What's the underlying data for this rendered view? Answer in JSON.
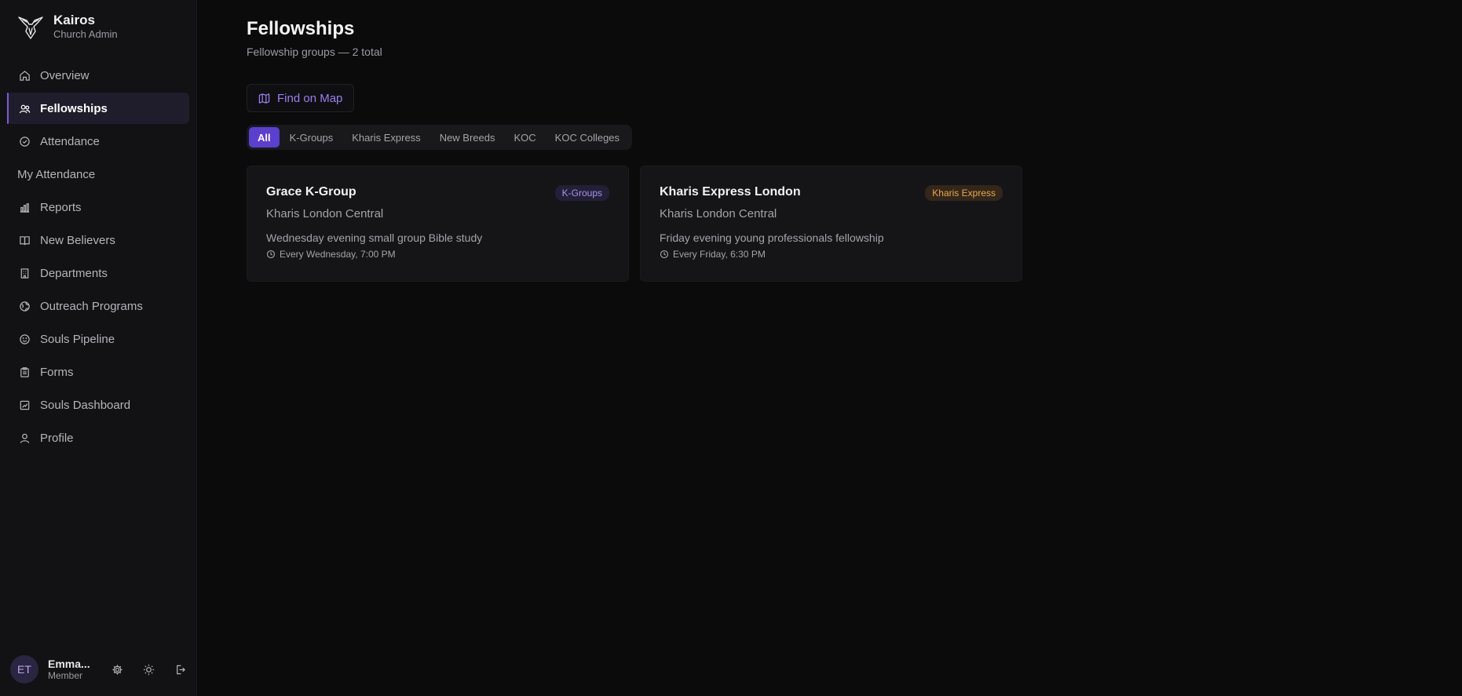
{
  "brand": {
    "title": "Kairos",
    "subtitle": "Church Admin",
    "logo_icon": "dove-icon"
  },
  "sidebar": {
    "items": [
      {
        "label": "Overview",
        "icon": "home-icon",
        "active": false
      },
      {
        "label": "Fellowships",
        "icon": "users-icon",
        "active": true
      },
      {
        "label": "Attendance",
        "icon": "check-circle-icon",
        "active": false
      },
      {
        "label": "My Attendance",
        "icon": "",
        "active": false
      },
      {
        "label": "Reports",
        "icon": "bar-chart-icon",
        "active": false
      },
      {
        "label": "New Believers",
        "icon": "book-icon",
        "active": false
      },
      {
        "label": "Departments",
        "icon": "building-icon",
        "active": false
      },
      {
        "label": "Outreach Programs",
        "icon": "globe-icon",
        "active": false
      },
      {
        "label": "Souls Pipeline",
        "icon": "smile-icon",
        "active": false
      },
      {
        "label": "Forms",
        "icon": "clipboard-icon",
        "active": false
      },
      {
        "label": "Souls Dashboard",
        "icon": "dashboard-icon",
        "active": false
      },
      {
        "label": "Profile",
        "icon": "user-icon",
        "active": false
      }
    ]
  },
  "user": {
    "initials": "ET",
    "name": "Emma...",
    "role": "Member"
  },
  "page": {
    "title": "Fellowships",
    "subtitle": "Fellowship groups — 2 total",
    "map_button": "Find on Map"
  },
  "tabs": [
    {
      "label": "All",
      "active": true
    },
    {
      "label": "K-Groups",
      "active": false
    },
    {
      "label": "Kharis Express",
      "active": false
    },
    {
      "label": "New Breeds",
      "active": false
    },
    {
      "label": "KOC",
      "active": false
    },
    {
      "label": "KOC Colleges",
      "active": false
    }
  ],
  "cards": [
    {
      "title": "Grace K-Group",
      "badge": "K-Groups",
      "badge_color": "#a893f0",
      "location": "Kharis London Central",
      "description": "Wednesday evening small group Bible study",
      "schedule": "Every Wednesday, 7:00 PM"
    },
    {
      "title": "Kharis Express London",
      "badge": "Kharis Express",
      "badge_color": "#e9a94a",
      "location": "Kharis London Central",
      "description": "Friday evening young professionals fellowship",
      "schedule": "Every Friday, 6:30 PM"
    }
  ],
  "colors": {
    "accent": "#5b3fd0",
    "accent_text": "#9a7ff0",
    "background": "#0b0b0c",
    "sidebar": "#121214"
  }
}
